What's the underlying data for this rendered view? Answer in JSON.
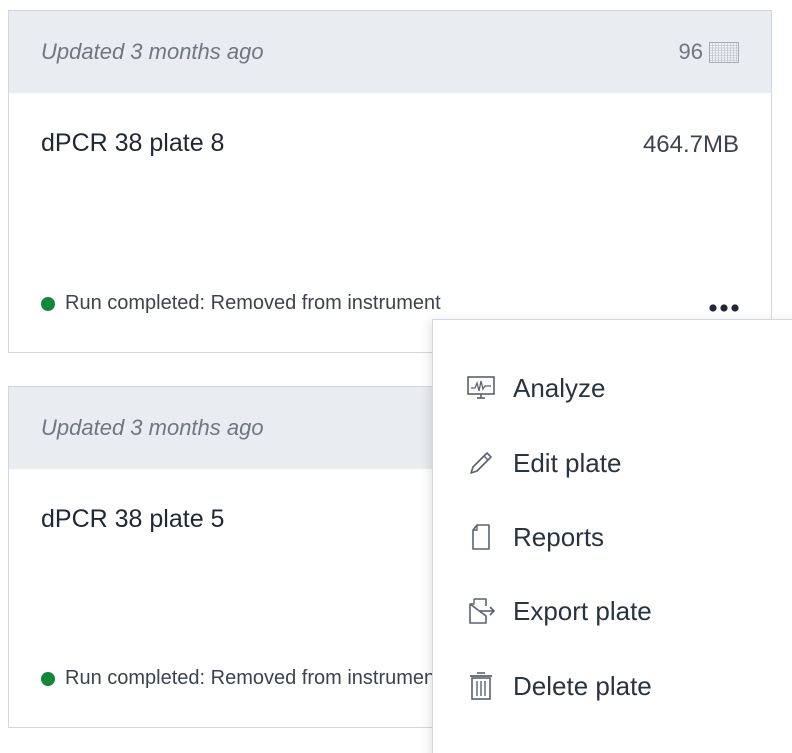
{
  "cards": [
    {
      "updated": "Updated 3 months ago",
      "well_count": "96",
      "plate_name": "dPCR 38 plate 8",
      "size": "464.7MB",
      "status": "Run completed:  Removed from instrument"
    },
    {
      "updated": "Updated 3 months ago",
      "plate_name": "dPCR 38 plate 5",
      "status": "Run completed:  Removed from instrument"
    }
  ],
  "menu": {
    "items": [
      {
        "label": "Analyze",
        "icon": "analyze-icon"
      },
      {
        "label": "Edit plate",
        "icon": "pencil-icon"
      },
      {
        "label": "Reports",
        "icon": "report-icon"
      },
      {
        "label": "Export plate",
        "icon": "export-icon"
      },
      {
        "label": "Delete plate",
        "icon": "trash-icon"
      }
    ]
  },
  "colors": {
    "status_green": "#11873a",
    "header_bg": "#e9ecf0",
    "border": "#d3d8e0"
  }
}
